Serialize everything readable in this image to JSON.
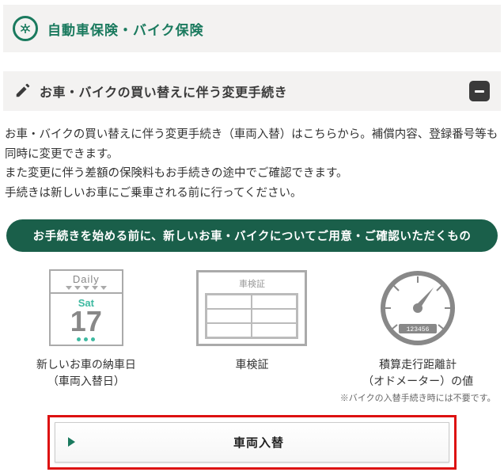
{
  "header": {
    "title": "自動車保険・バイク保険"
  },
  "section": {
    "title": "お車・バイクの買い替えに伴う変更手続き"
  },
  "body": {
    "p1": "お車・バイクの買い替えに伴う変更手続き（車両入替）はこちらから。補償内容、登録番号等も同時に変更できます。",
    "p2": "また変更に伴う差額の保険料もお手続きの途中でご確認できます。",
    "p3": "手続きは新しいお車にご乗車される前に行ってください。"
  },
  "prep_banner": "お手続きを始める前に、新しいお車・バイクについてご用意・ご確認いただくもの",
  "items": [
    {
      "label": "新しいお車の納車日\n（車両入替日）",
      "calendar": {
        "daily": "Daily",
        "day": "Sat",
        "num": "17"
      }
    },
    {
      "label": "車検証",
      "doc_title": "車検証"
    },
    {
      "label": "積算走行距離計\n（オドメーター）の値",
      "sub": "※バイクの入替手続き時には不要です。",
      "gauge_digits": "123456"
    }
  ],
  "cta": {
    "label": "車両入替"
  }
}
